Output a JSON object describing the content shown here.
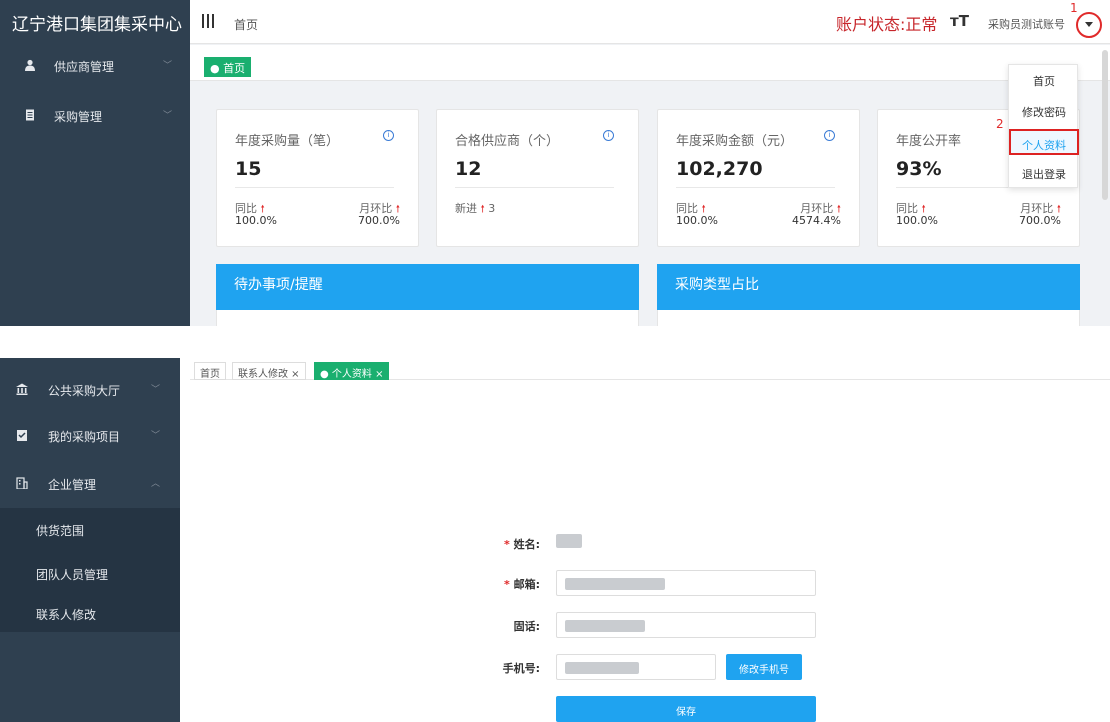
{
  "top": {
    "brand": "辽宁港口集团集采中心",
    "sidebar": [
      {
        "label": "供应商管理"
      },
      {
        "label": "采购管理"
      }
    ],
    "breadcrumb": "首页",
    "account_status": "账户状态:正常",
    "font_toggle": "тT",
    "user_name": "采购员测试账号",
    "step1": "1",
    "step2": "2",
    "active_tab": "● 首页",
    "cards": [
      {
        "title": "年度采购量（笔）",
        "value": "15",
        "k1": "同比",
        "v1": "100.0%",
        "k2": "月环比",
        "v2": "700.0%"
      },
      {
        "title": "合格供应商（个）",
        "value": "12",
        "k1": "新进",
        "v1": "3"
      },
      {
        "title": "年度采购金额（元）",
        "value": "102,270",
        "k1": "同比",
        "v1": "100.0%",
        "k2": "月环比",
        "v2": "4574.4%"
      },
      {
        "title": "年度公开率",
        "value": "93%",
        "k1": "同比",
        "v1": "100.0%",
        "k2": "月环比",
        "v2": "700.0%"
      }
    ],
    "panels": {
      "todo": "待办事项/提醒",
      "purchase_type": "采购类型占比"
    },
    "dropdown": [
      {
        "label": "首页"
      },
      {
        "label": "修改密码"
      },
      {
        "label": "个人资料"
      },
      {
        "label": "退出登录"
      }
    ]
  },
  "bottom": {
    "sidebar": [
      {
        "label": "公共采购大厅"
      },
      {
        "label": "我的采购项目"
      },
      {
        "label": "企业管理"
      }
    ],
    "sub_items": [
      {
        "label": "供货范围"
      },
      {
        "label": "团队人员管理"
      },
      {
        "label": "联系人修改"
      }
    ],
    "tabs": [
      {
        "label": "首页"
      },
      {
        "label": "联系人修改 ×"
      },
      {
        "label": "● 个人资料 ×"
      }
    ],
    "form": {
      "name_label": "姓名:",
      "email_label": "邮箱:",
      "phone_label": "固话:",
      "mobile_label": "手机号:",
      "change_mobile_btn": "修改手机号",
      "save_btn": "保存",
      "required_mark": "*"
    }
  },
  "colors": {
    "sidebar": "#2f4050",
    "accent": "#1fa3f0",
    "green": "#1aaf6f",
    "red": "#e02a2a"
  }
}
